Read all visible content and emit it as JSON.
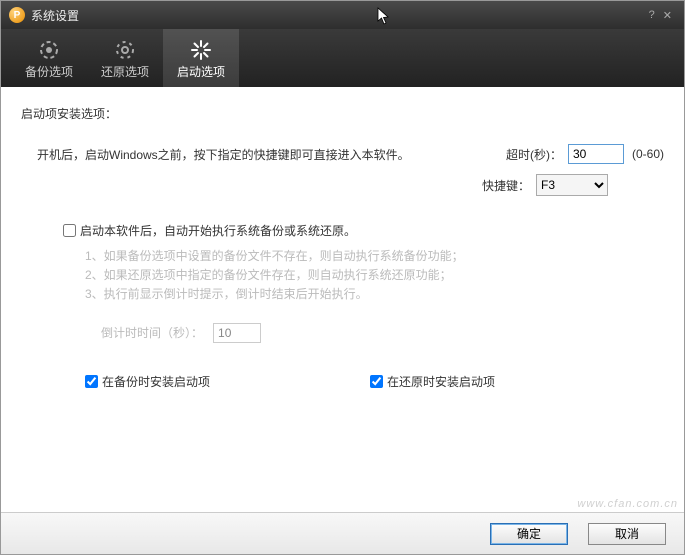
{
  "titlebar": {
    "title": "系统设置"
  },
  "tabs": {
    "backup": "备份选项",
    "restore": "还原选项",
    "startup": "启动选项"
  },
  "section_title": "启动项安装选项：",
  "desc_line": "开机后，启动Windows之前，按下指定的快捷键即可直接进入本软件。",
  "timeout": {
    "label": "超时(秒)：",
    "value": "30",
    "hint": "(0-60)"
  },
  "hotkey": {
    "label": "快捷键：",
    "value": "F3"
  },
  "auto_checkbox": "启动本软件后，自动开始执行系统备份或系统还原。",
  "hints": {
    "h1": "1、如果备份选项中设置的备份文件不存在，则自动执行系统备份功能；",
    "h2": "2、如果还原选项中指定的备份文件存在，则自动执行系统还原功能；",
    "h3": "3、执行前显示倒计时提示，倒计时结束后开始执行。"
  },
  "countdown": {
    "label": "倒计时时间（秒）：",
    "value": "10"
  },
  "install": {
    "on_backup": "在备份时安装启动项",
    "on_restore": "在还原时安装启动项"
  },
  "footer": {
    "ok": "确定",
    "cancel": "取消"
  },
  "watermark": "www.cfan.com.cn"
}
